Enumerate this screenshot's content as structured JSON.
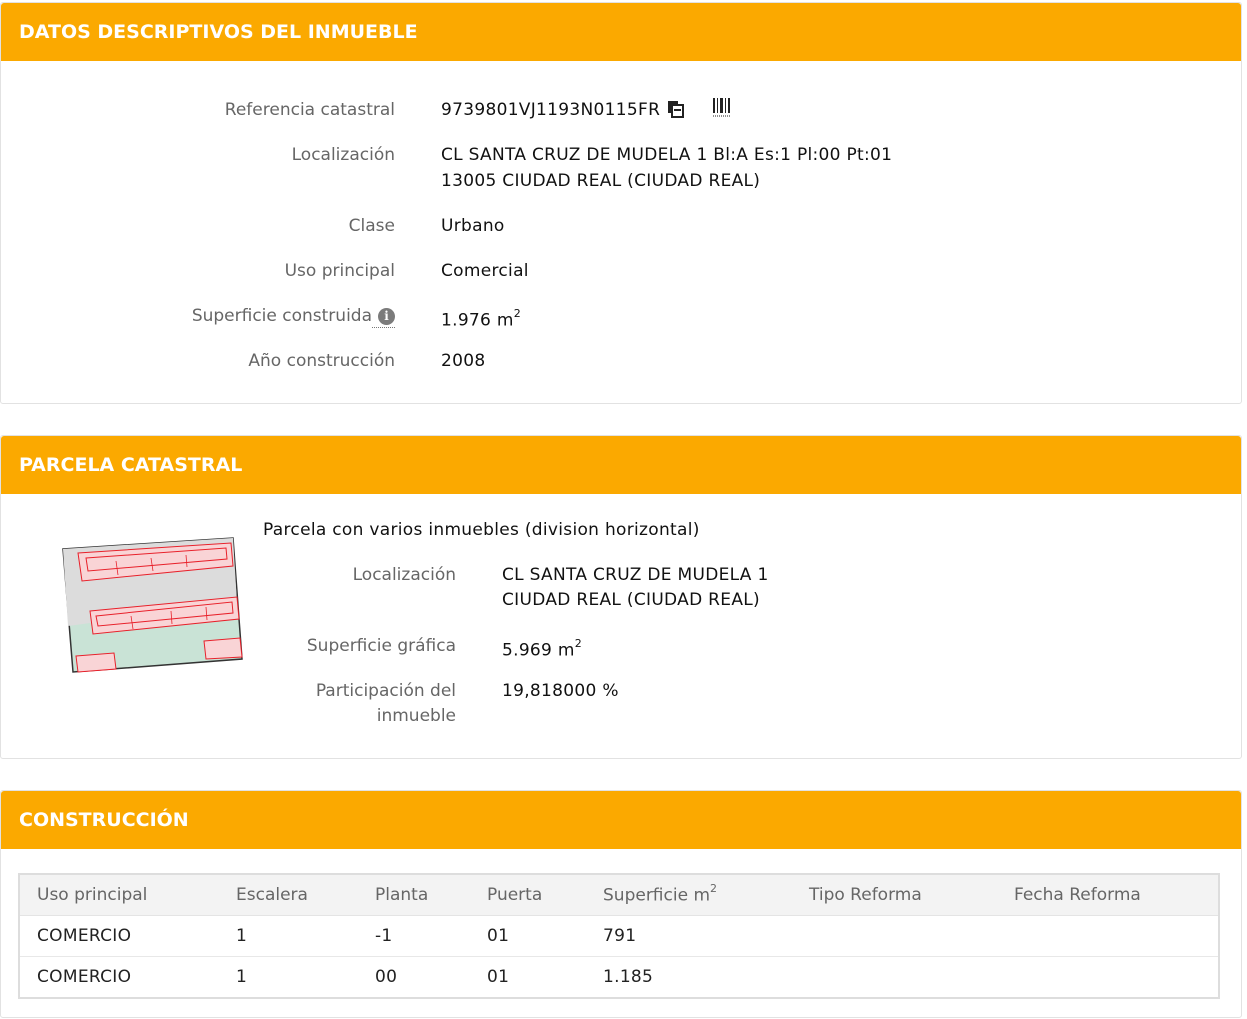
{
  "datos": {
    "header": "DATOS DESCRIPTIVOS DEL INMUEBLE",
    "referencia": {
      "label": "Referencia catastral",
      "value": "9739801VJ1193N0115FR"
    },
    "localizacion": {
      "label": "Localización",
      "line1": "CL SANTA CRUZ DE MUDELA 1 Bl:A Es:1 Pl:00 Pt:01",
      "line2": "13005 CIUDAD REAL (CIUDAD REAL)"
    },
    "clase": {
      "label": "Clase",
      "value": "Urbano"
    },
    "uso": {
      "label": "Uso principal",
      "value": "Comercial"
    },
    "superficie": {
      "label": "Superficie construida",
      "value": "1.976 m",
      "unit_sup": "2"
    },
    "anio": {
      "label": "Año construcción",
      "value": "2008"
    }
  },
  "parcela": {
    "header": "PARCELA CATASTRAL",
    "title": "Parcela con varios inmuebles (division horizontal)",
    "localizacion": {
      "label": "Localización",
      "line1": "CL SANTA CRUZ DE MUDELA 1",
      "line2": "CIUDAD REAL (CIUDAD REAL)"
    },
    "superficie": {
      "label": "Superficie gráfica",
      "value": "5.969 m",
      "unit_sup": "2"
    },
    "participacion": {
      "label_line1": "Participación del",
      "label_line2": "inmueble",
      "value": "19,818000 %"
    }
  },
  "construccion": {
    "header": "CONSTRUCCIÓN",
    "columns": [
      "Uso principal",
      "Escalera",
      "Planta",
      "Puerta",
      "Superficie m",
      "Tipo Reforma",
      "Fecha Reforma"
    ],
    "superficie_sup": "2",
    "rows": [
      [
        "COMERCIO",
        "1",
        "-1",
        "01",
        "791",
        "",
        ""
      ],
      [
        "COMERCIO",
        "1",
        "00",
        "01",
        "1.185",
        "",
        ""
      ]
    ]
  },
  "icons": {
    "copy": "copy-icon",
    "barcode": "barcode-icon",
    "info": "info-icon"
  },
  "colors": {
    "header": "#fba900",
    "parcel_fill": "#c9e3d6",
    "building_outline": "#e8202a"
  }
}
